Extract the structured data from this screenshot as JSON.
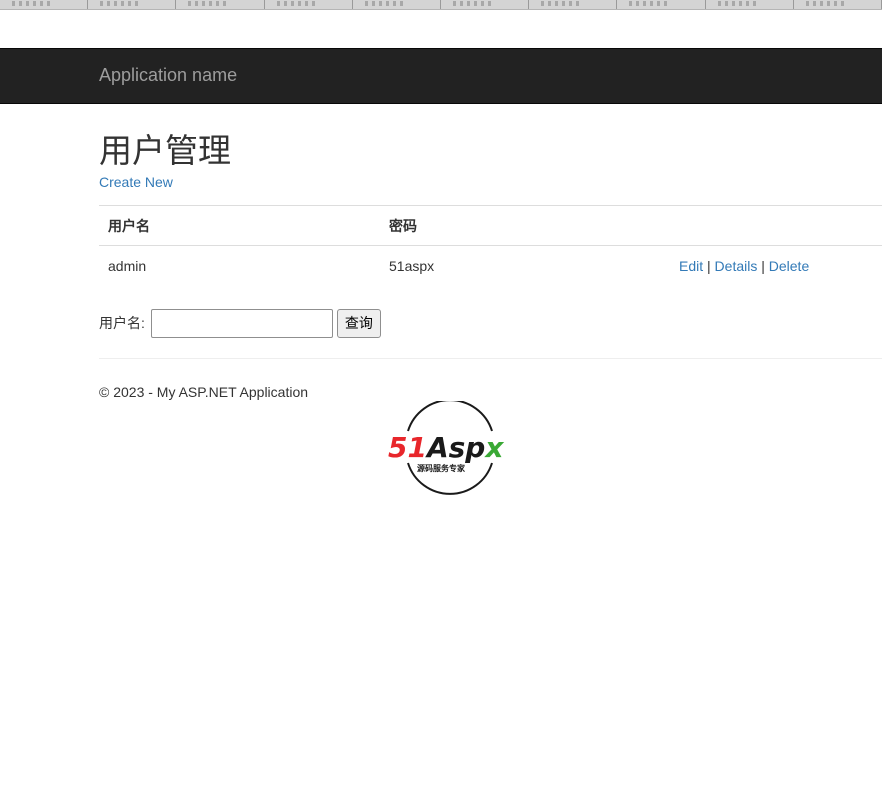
{
  "navbar": {
    "brand": "Application name"
  },
  "page": {
    "title": "用户管理",
    "create_link": "Create New"
  },
  "table": {
    "headers": [
      "用户名",
      "密码",
      ""
    ],
    "rows": [
      {
        "username": "admin",
        "password": "51aspx",
        "actions": {
          "edit": "Edit",
          "details": "Details",
          "delete": "Delete",
          "separator": "|"
        }
      }
    ]
  },
  "search": {
    "label": "用户名:",
    "value": "",
    "button": "查询"
  },
  "footer": {
    "text": "© 2023 - My ASP.NET Application"
  },
  "logo": {
    "brand_red": "51",
    "brand_black": "Asp",
    "brand_green": "x",
    "tagline": "源码服务专家",
    "colors": {
      "red": "#e8262b",
      "black": "#1a1a1a",
      "green": "#3aa935"
    }
  }
}
